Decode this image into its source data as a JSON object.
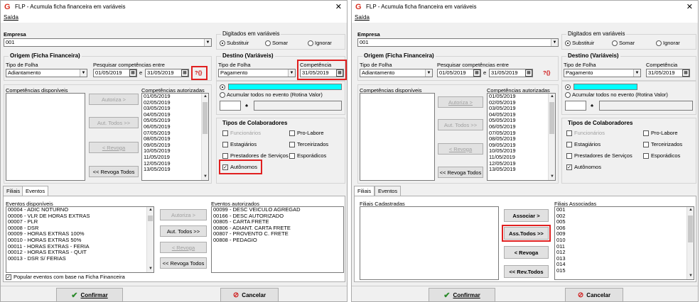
{
  "w1": {
    "title": "FLP - Acumula ficha financeira em variáveis",
    "menu": "Saída",
    "empresa_label": "Empresa",
    "empresa_value": "001",
    "dig_group": "Digitados em variáveis",
    "opt_sub": "Substituir",
    "opt_somar": "Somar",
    "opt_ignorar": "Ignorar",
    "origem_title": "Origem (Ficha Financeira)",
    "tipo_label": "Tipo de Folha",
    "tipo_value": "Adiantamento",
    "pesq_label": "Pesquisar competências entre",
    "date1": "01/05/2019",
    "e": "e",
    "date2": "31/05/2019",
    "help": "?{}",
    "destino_title": "Destino (Variáveis)",
    "dest_tipo_label": "Tipo de Folha",
    "dest_tipo_value": "Pagamento",
    "comp_label": "Competência",
    "comp_value": "31/05/2019",
    "acum_label": "Acumular todos no evento (Rotina Valor)",
    "comp_disp": "Competências disponíveis",
    "comp_aut": "Competências autorizadas",
    "comp_list": [
      "01/05/2019",
      "02/05/2019",
      "03/05/2019",
      "04/05/2019",
      "05/05/2019",
      "06/05/2019",
      "07/05/2019",
      "08/05/2019",
      "09/05/2019",
      "10/05/2019",
      "11/05/2019",
      "12/05/2019",
      "13/05/2019"
    ],
    "btn_autoriza": "Autoriza >",
    "btn_aut_todos": "Aut. Todos >>",
    "btn_revoga": "< Revoga",
    "btn_revoga_todos": "<< Revoga Todos",
    "tipos_title": "Tipos de Colaboradores",
    "t_func": "Funcionários",
    "t_prolabore": "Pro-Labore",
    "t_estag": "Estagiários",
    "t_terc": "Terceirizados",
    "t_prest": "Prestadores de Serviços",
    "t_espor": "Esporádicos",
    "t_auton": "Autônomos",
    "tab_filiais": "Filiais",
    "tab_eventos": "Eventos",
    "ev_disp": "Eventos disponíveis",
    "ev_aut": "Eventos autorizados",
    "ev_list": [
      "00004 - ADIC NOTURNO",
      "00006 - VLR DE HORAS EXTRAS",
      "00007 - PLR",
      "00008 - DSR",
      "00009 - HORAS EXTRAS 100%",
      "00010 - HORAS EXTRAS 50%",
      "00011 - HORAS EXTRAS - FERIA",
      "00012 - HORAS EXTRAS - QUIT",
      "00013 - DSR S/ FERIAS"
    ],
    "ev_aut_list": [
      "00099 - DESC VEICULO AGREGAD",
      "00166 - DESC AUTORIZADO",
      "00805 - CARTA FRETE",
      "00806 - ADIANT. CARTA FRETE",
      "00807 - PROVENTO C. FRETE",
      "00808 - PEDAGIO"
    ],
    "ev_btn_autoriza": "Autoriza >",
    "ev_btn_aut_todos": "Aut. Todos >>",
    "ev_btn_revoga": "< Revoga",
    "ev_btn_revoga_todos": "<< Revoga Todos",
    "popular": "Popular eventos com base na Ficha Financeira",
    "confirmar": "Confirmar",
    "cancelar": "Cancelar"
  },
  "w2": {
    "title": "FLP - Acumula ficha financeira em variáveis",
    "menu": "Saída",
    "empresa_label": "Empresa",
    "empresa_value": "001",
    "dig_group": "Digitados em variáveis",
    "opt_sub": "Substituir",
    "opt_somar": "Somar",
    "opt_ignorar": "Ignorar",
    "origem_title": "Origem (Ficha Financeira)",
    "tipo_label": "Tipo de Folha",
    "tipo_value": "Adiantamento",
    "pesq_label": "Pesquisar competências entre",
    "date1": "01/05/2019",
    "e": "e",
    "date2": "31/05/2019",
    "help": "?{}",
    "destino_title": "Destino (Variáveis)",
    "dest_tipo_label": "Tipo de Folha",
    "dest_tipo_value": "Pagamento",
    "comp_label": "Competência",
    "comp_value": "31/05/2019",
    "acum_label": "Acumular todos no evento (Rotina Valor)",
    "comp_disp": "Competências disponíveis",
    "comp_aut": "Competências autorizadas",
    "comp_list": [
      "01/05/2019",
      "02/05/2019",
      "03/05/2019",
      "04/05/2019",
      "05/05/2019",
      "06/05/2019",
      "07/05/2019",
      "08/05/2019",
      "09/05/2019",
      "10/05/2019",
      "11/05/2019",
      "12/05/2019",
      "13/05/2019"
    ],
    "btn_autoriza": "Autoriza >",
    "btn_aut_todos": "Aut. Todos >>",
    "btn_revoga": "< Revoga",
    "btn_revoga_todos": "<< Revoga Todos",
    "tipos_title": "Tipos de Colaboradores",
    "t_func": "Funcionários",
    "t_prolabore": "Pro-Labore",
    "t_estag": "Estagiários",
    "t_terc": "Terceirizados",
    "t_prest": "Prestadores de Serviços",
    "t_espor": "Esporádicos",
    "t_auton": "Autônomos",
    "tab_filiais": "Filiais",
    "tab_eventos": "Eventos",
    "fil_cad": "Filiais Cadastradas",
    "fil_assoc": "Filiais Associadas",
    "fil_list": [
      "001",
      "002",
      "005",
      "006",
      "009",
      "010",
      "011",
      "012",
      "013",
      "014",
      "015"
    ],
    "btn_associar": "Associar >",
    "btn_ass_todos": "Ass.Todos >>",
    "btn_f_revoga": "< Revoga",
    "btn_rev_todos": "<< Rev.Todos",
    "confirmar": "Confirmar",
    "cancelar": "Cancelar"
  }
}
